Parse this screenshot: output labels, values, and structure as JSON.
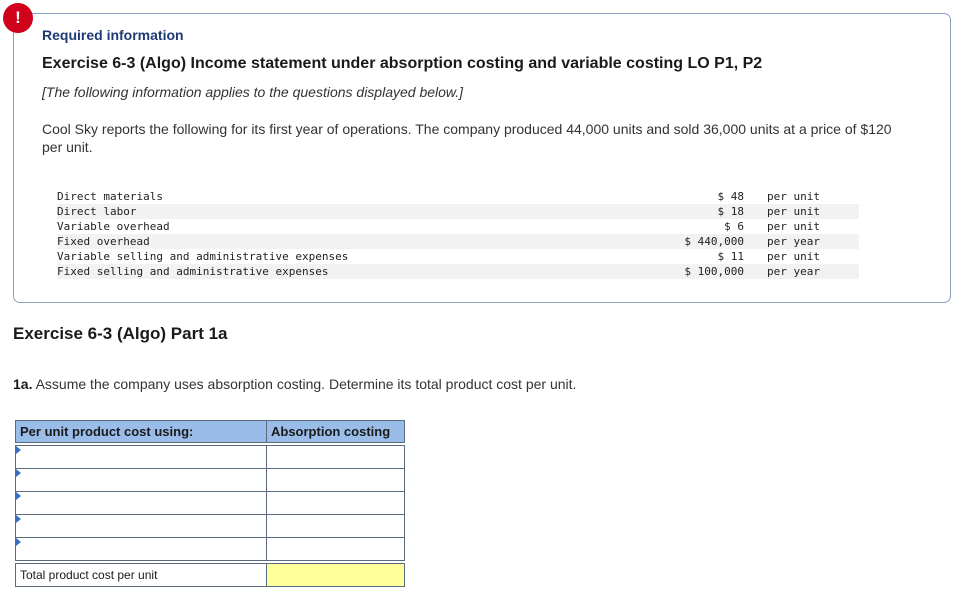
{
  "alert": {
    "symbol": "!"
  },
  "info": {
    "required": "Required information",
    "title": "Exercise 6-3 (Algo) Income statement under absorption costing and variable costing LO P1, P2",
    "note": "[The following information applies to the questions displayed below.]",
    "description": "Cool Sky reports the following for its first year of operations. The company produced 44,000 units and sold 36,000 units at a price of $120 per unit.",
    "rows": [
      {
        "label": "Direct materials",
        "amount": "$ 48",
        "per": "per unit"
      },
      {
        "label": "Direct labor",
        "amount": "$ 18",
        "per": "per unit"
      },
      {
        "label": "Variable overhead",
        "amount": "$ 6",
        "per": "per unit"
      },
      {
        "label": "Fixed overhead",
        "amount": "$ 440,000",
        "per": "per year"
      },
      {
        "label": "Variable selling and administrative expenses",
        "amount": "$ 11",
        "per": "per unit"
      },
      {
        "label": "Fixed selling and administrative expenses",
        "amount": "$ 100,000",
        "per": "per year"
      }
    ]
  },
  "part": {
    "title": "Exercise 6-3 (Algo) Part 1a",
    "question_prefix": "1a.",
    "question_text": " Assume the company uses absorption costing. Determine its total product cost per unit."
  },
  "answer_table": {
    "header_left": "Per unit product cost using:",
    "header_right": "Absorption costing",
    "total_label": "Total product cost per unit"
  }
}
